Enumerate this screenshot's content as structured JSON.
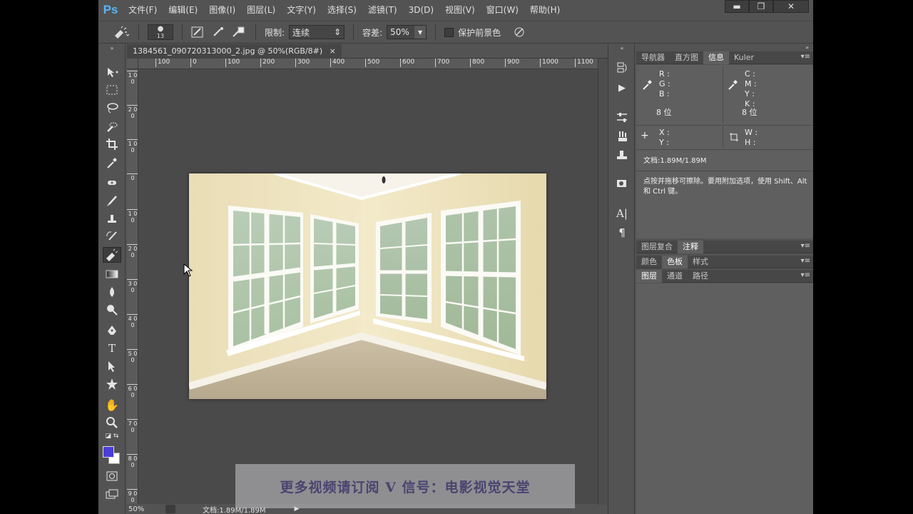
{
  "app": {
    "logo": "Ps"
  },
  "menu": [
    "文件(F)",
    "编辑(E)",
    "图像(I)",
    "图层(L)",
    "文字(Y)",
    "选择(S)",
    "滤镜(T)",
    "3D(D)",
    "视图(V)",
    "窗口(W)",
    "帮助(H)"
  ],
  "window_controls": {
    "minimize": "▬",
    "restore": "❐",
    "close": "✕"
  },
  "options": {
    "brush_size": "13",
    "limit_label": "限制:",
    "limit_value": "连续",
    "tolerance_label": "容差:",
    "tolerance_value": "50%",
    "protect_fg_label": "保护前景色"
  },
  "document": {
    "tab_title": "1384561_090720313000_2.jpg @ 50%(RGB/8#)",
    "tab_close": "×",
    "ruler_h": [
      "100",
      "0",
      "100",
      "200",
      "300",
      "400",
      "500",
      "600",
      "700",
      "800",
      "900",
      "1000",
      "1100"
    ],
    "ruler_v": [
      "1 0 0",
      "0",
      "2 0 0",
      "1 0 0",
      "0",
      "1 0 0",
      "2 0 0",
      "3 0 0",
      "4 0 0",
      "5 0 0",
      "6 0 0",
      "7 0 0",
      "8 0 0",
      "9 0 0"
    ],
    "zoom": "50%",
    "status_doc": "文档:1.89M/1.89M"
  },
  "watermark": "更多视频请订阅 V 信号：电影视觉天堂",
  "panels": {
    "group1_tabs": [
      "导航器",
      "直方图",
      "信息",
      "Kuler"
    ],
    "group1_active": 2,
    "info": {
      "r": "R :",
      "g": "G :",
      "b": "B :",
      "bits_left": "8 位",
      "c": "C :",
      "m": "M :",
      "y": "Y :",
      "k": "K :",
      "bits_right": "8 位",
      "x": "X :",
      "y2": "Y :",
      "w": "W :",
      "h": "H :",
      "doc": "文档:1.89M/1.89M",
      "hint": "点按并拖移可擦除。要用附加选项，使用 Shift、Alt 和 Ctrl 键。"
    },
    "group2_tabs": [
      "图层复合",
      "注释"
    ],
    "group2_active": 1,
    "group3_tabs": [
      "颜色",
      "色板",
      "样式"
    ],
    "group3_active": 1,
    "group4_tabs": [
      "图层",
      "通道",
      "路径"
    ],
    "group4_active": 0
  },
  "colors": {
    "foreground": "#4a3fd8",
    "background": "#ffffff",
    "logo": "#5ab4f8"
  }
}
